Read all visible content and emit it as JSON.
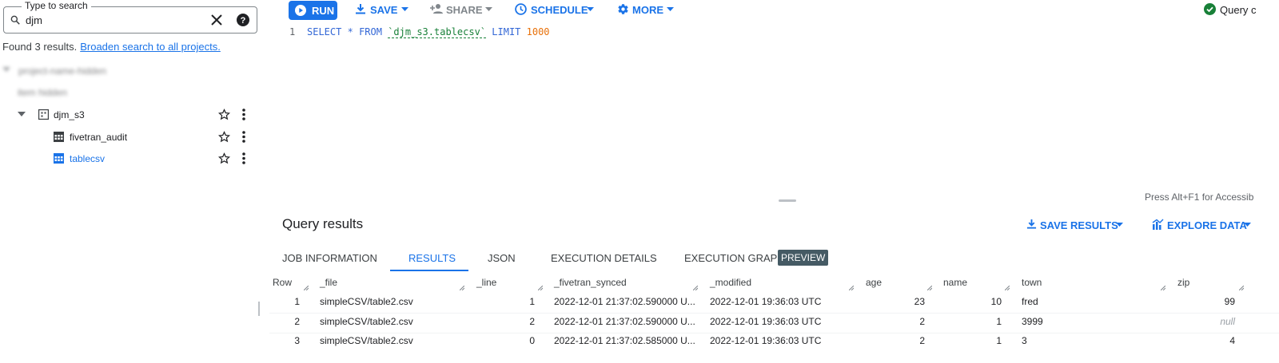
{
  "search": {
    "legend": "Type to search",
    "value": "djm",
    "found_text": "Found 3 results.",
    "broaden_link": "Broaden search to all projects."
  },
  "tree": {
    "dataset": "djm_s3",
    "tables": [
      "fivetran_audit",
      "tablecsv"
    ],
    "blurred_rows": [
      "project-name-hidden",
      "item hidden"
    ]
  },
  "toolbar": {
    "run": "RUN",
    "save": "SAVE",
    "share": "SHARE",
    "schedule": "SCHEDULE",
    "more": "MORE",
    "status": "Query c"
  },
  "editor": {
    "line_number": "1",
    "tokens": {
      "select": "SELECT",
      "star": "*",
      "from": "FROM",
      "table": "`djm_s3.tablecsv`",
      "limit": "LIMIT",
      "limit_value": "1000"
    },
    "a11y_hint": "Press Alt+F1 for Accessib"
  },
  "results": {
    "title": "Query results",
    "save_results": "SAVE RESULTS",
    "explore_data": "EXPLORE DATA",
    "tabs": [
      "JOB INFORMATION",
      "RESULTS",
      "JSON",
      "EXECUTION DETAILS",
      "EXECUTION GRAPH"
    ],
    "preview_badge": "PREVIEW",
    "columns": [
      "Row",
      "_file",
      "_line",
      "_fivetran_synced",
      "_modified",
      "age",
      "name",
      "town",
      "zip"
    ],
    "rows": [
      [
        "1",
        "simpleCSV/table2.csv",
        "1",
        "2022-12-01 21:37:02.590000 U...",
        "2022-12-01 19:36:03 UTC",
        "23",
        "10",
        "fred",
        "99"
      ],
      [
        "2",
        "simpleCSV/table2.csv",
        "2",
        "2022-12-01 21:37:02.590000 U...",
        "2022-12-01 19:36:03 UTC",
        "2",
        "1",
        "3999",
        "null"
      ],
      [
        "3",
        "simpleCSV/table2.csv",
        "0",
        "2022-12-01 21:37:02.585000 U...",
        "2022-12-01 19:36:03 UTC",
        "2",
        "1",
        "3",
        "4"
      ]
    ]
  },
  "colors": {
    "accent": "#1a73e8",
    "success": "#188038",
    "number_literal": "#e8710a"
  }
}
